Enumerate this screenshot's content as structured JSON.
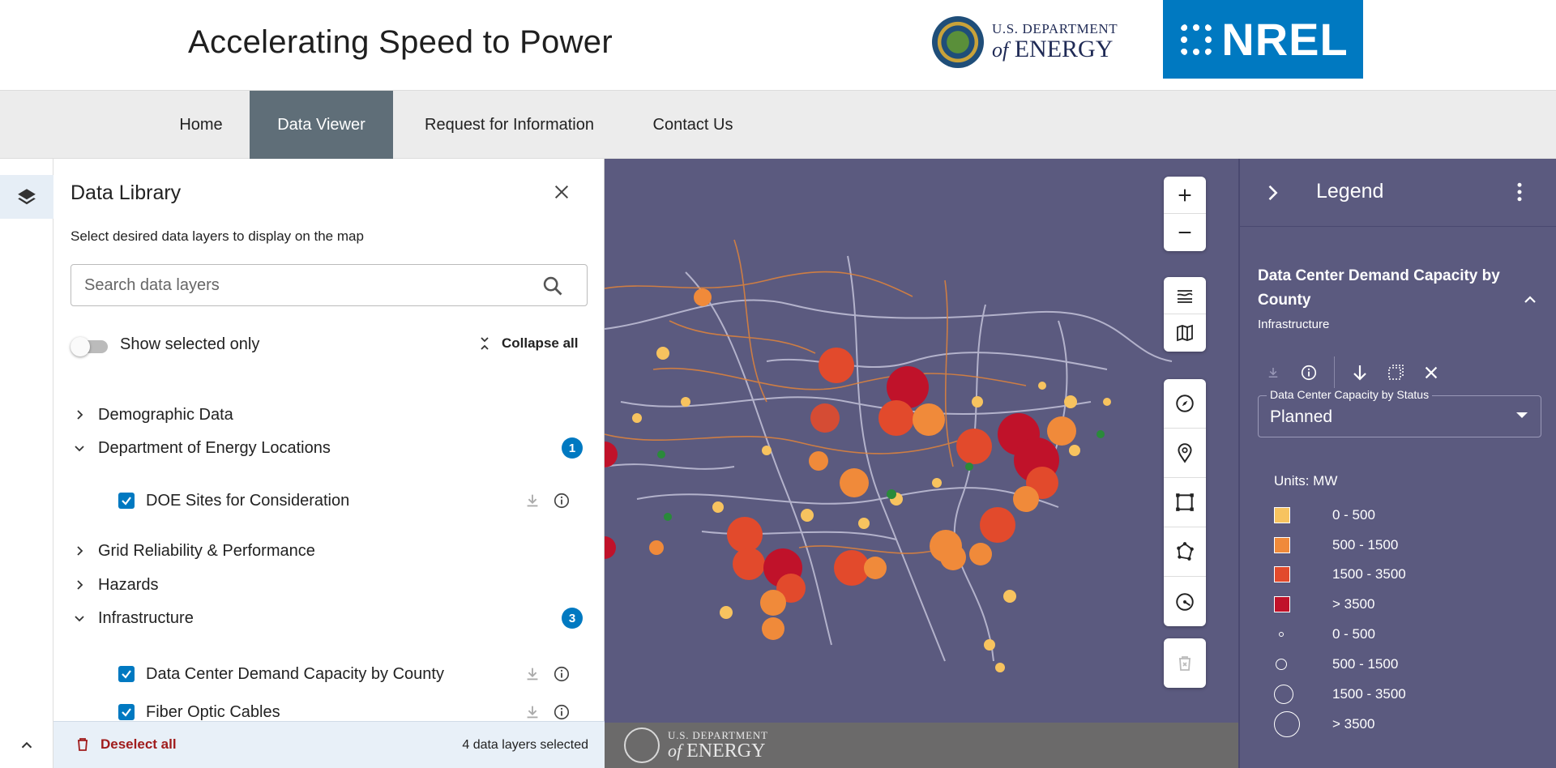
{
  "header": {
    "title": "Accelerating Speed to Power",
    "doe_logo": {
      "line1": "U.S. DEPARTMENT",
      "line2_prefix": "of",
      "line2_main": "ENERGY"
    },
    "nrel_logo": {
      "text": "NREL",
      "color": "#0079c1"
    }
  },
  "nav": {
    "items": [
      {
        "label": "Home"
      },
      {
        "label": "Data Viewer",
        "active": true
      },
      {
        "label": "Request for Information"
      },
      {
        "label": "Contact Us"
      }
    ],
    "active_color": "#5f6e78"
  },
  "rail": {
    "layers_icon": "layers-icon",
    "expand_icon": "chevron-up-icon"
  },
  "library": {
    "title": "Data Library",
    "subtitle": "Select desired data layers to display on the map",
    "search": {
      "placeholder": "Search data layers",
      "value": ""
    },
    "show_selected_only": {
      "label": "Show selected only",
      "on": false
    },
    "collapse_all_label": "Collapse all",
    "categories": [
      {
        "label": "Demographic Data",
        "expanded": false
      },
      {
        "label": "Department of Energy Locations",
        "expanded": true,
        "badge": "1"
      },
      {
        "label": "Grid Reliability & Performance",
        "expanded": false
      },
      {
        "label": "Hazards",
        "expanded": false
      },
      {
        "label": "Infrastructure",
        "expanded": true,
        "badge": "3"
      }
    ],
    "layers": [
      {
        "label": "DOE Sites for Consideration",
        "checked": true
      },
      {
        "label": "Data Center Demand Capacity by County",
        "checked": true
      },
      {
        "label": "Fiber Optic Cables",
        "checked": true
      }
    ],
    "footer": {
      "deselect_label": "Deselect all",
      "selected_count": "4 data layers selected"
    }
  },
  "map": {
    "background": "#5b5a7f",
    "footer_logo": {
      "line1": "U.S. DEPARTMENT",
      "line2_prefix": "of",
      "line2_main": "ENERGY"
    },
    "tools": [
      "plus-icon",
      "minus-icon",
      "basemap-icon",
      "map-icon",
      "compass-icon",
      "location-pin-icon",
      "draw-rectangle-icon",
      "draw-polygon-icon",
      "draw-radius-icon",
      "trash-icon"
    ]
  },
  "legend": {
    "title": "Legend",
    "layer_name": "Data Center Demand Capacity by County",
    "layer_category": "Infrastructure",
    "status_select": {
      "label": "Data Center Capacity by Status",
      "value": "Planned"
    },
    "units": "Units: MW",
    "color_items": [
      {
        "label": "0 - 500",
        "color": "#f7c35f"
      },
      {
        "label": "500 - 1500",
        "color": "#f08a3a"
      },
      {
        "label": "1500 - 3500",
        "color": "#e24a2c"
      },
      {
        "label": "> 3500",
        "color": "#c0122a"
      }
    ],
    "size_items": [
      {
        "label": "0 - 500"
      },
      {
        "label": "500 - 1500"
      },
      {
        "label": "1500 - 3500"
      },
      {
        "label": "> 3500"
      }
    ]
  }
}
